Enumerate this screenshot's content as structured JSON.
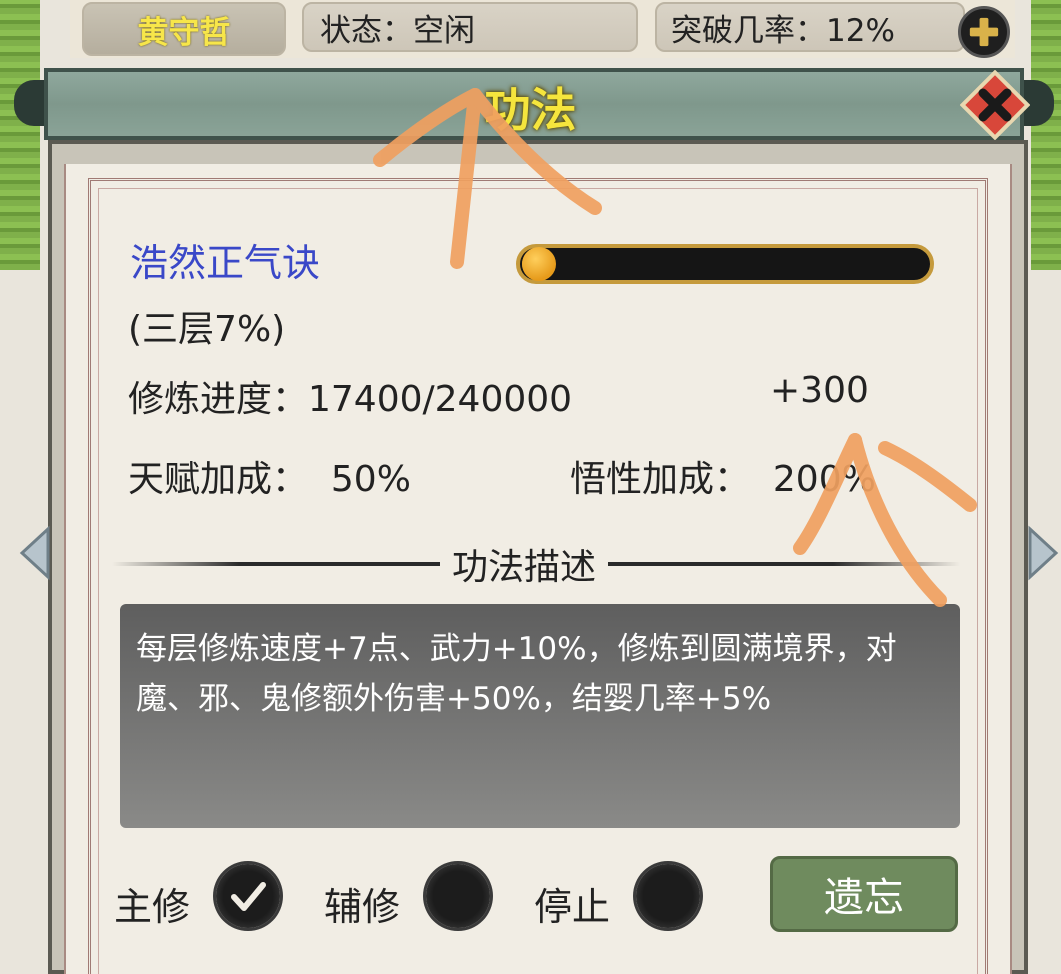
{
  "header": {
    "character_name": "黄守哲",
    "status": "状态：空闲",
    "breakthrough": "突破几率：12%"
  },
  "title": "功法",
  "skill": {
    "name": "浩然正气诀",
    "layer": "(三层7%)",
    "progress_fraction": 0.07,
    "cultivation_progress": "修炼进度：17400/240000",
    "cultivation_bonus": "+300",
    "talent_bonus": "天赋加成：  50%",
    "insight_bonus": "悟性加成：  200%"
  },
  "description": {
    "heading": "功法描述",
    "text": "每层修炼速度+7点、武力+10%，修炼到圆满境界，对魔、邪、鬼修额外伤害+50%，结婴几率+5%"
  },
  "options": {
    "main": "主修",
    "aux": "辅修",
    "stop": "停止",
    "selected": "main"
  },
  "forget_button": "遗忘",
  "colors": {
    "title_yellow": "#f5e53d",
    "skill_name_blue": "#3a48c8",
    "forget_green": "#6f8b5e",
    "annotation_orange": "#f0a060"
  }
}
